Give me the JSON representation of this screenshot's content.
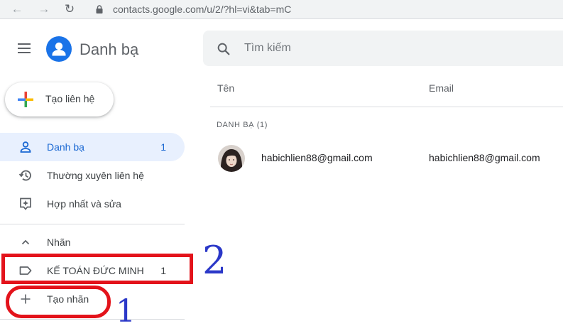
{
  "browser": {
    "url": "contacts.google.com/u/2/?hl=vi&tab=mC",
    "icons": [
      "back-arrow-icon",
      "forward-arrow-icon",
      "reload-icon",
      "lock-icon"
    ]
  },
  "header": {
    "title": "Danh bạ",
    "search_placeholder": "Tìm kiếm"
  },
  "create_button": {
    "label": "Tạo liên hệ"
  },
  "sidebar": {
    "items": [
      {
        "label": "Danh bạ",
        "count": "1",
        "icon": "person-icon",
        "active": true
      },
      {
        "label": "Thường xuyên liên hệ",
        "icon": "history-icon"
      },
      {
        "label": "Hợp nhất và sửa",
        "icon": "merge-fix-icon"
      }
    ],
    "labels_header": "Nhãn",
    "labels": [
      {
        "label": "KẾ TOÁN ĐỨC MINH",
        "count": "1",
        "icon": "label-icon"
      }
    ],
    "create_label": "Tạo nhãn"
  },
  "table": {
    "columns": [
      "Tên",
      "Email"
    ],
    "section": "DANH BẠ (1)",
    "rows": [
      {
        "name": "habichlien88@gmail.com",
        "email": "habichlien88@gmail.com"
      }
    ]
  },
  "annotations": {
    "numbers": [
      "2",
      "1"
    ],
    "color_box": "#e3131b",
    "color_number": "#2b38c8"
  },
  "colors": {
    "accent": "#1a73e8",
    "active_bg": "#e8f0fe",
    "active_text": "#1967d2"
  }
}
